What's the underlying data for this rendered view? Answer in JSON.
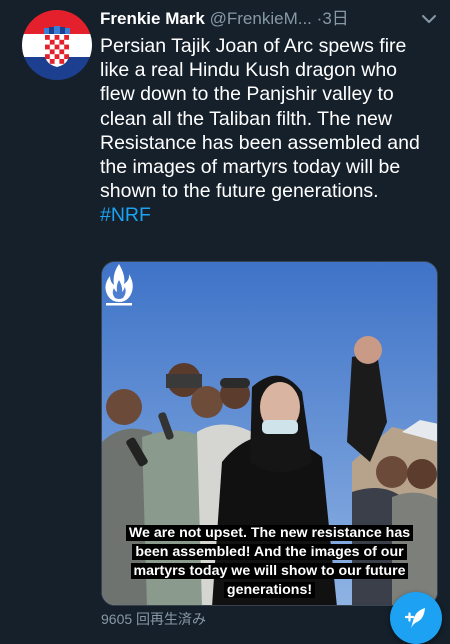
{
  "tweet": {
    "author_name": "Frenkie Mark",
    "author_handle": "@FrenkieM...",
    "separator": "·",
    "time": "3日",
    "text": "Persian Tajik Joan of Arc spews fire like a real Hindu Kush dragon who flew down to the Panjshir valley to clean all the Taliban filth. The new Resistance has been assembled and the images of martyrs today will be shown to the future generations.",
    "hashtag": "#NRF",
    "avatar_icon": "croatia-flag-icon",
    "more_icon": "chevron-down-icon"
  },
  "media": {
    "caption": "We are not upset. The new resistance has been assembled! And the images of our martyrs today we will show to our future generations!",
    "watermark_icon": "flame-logo-icon"
  },
  "footer": {
    "views": "9605 回再生済み"
  },
  "fab": {
    "icon": "compose-tweet-icon"
  },
  "colors": {
    "background": "#15202b",
    "accent": "#1da1f2",
    "secondary_text": "#8899a6"
  }
}
